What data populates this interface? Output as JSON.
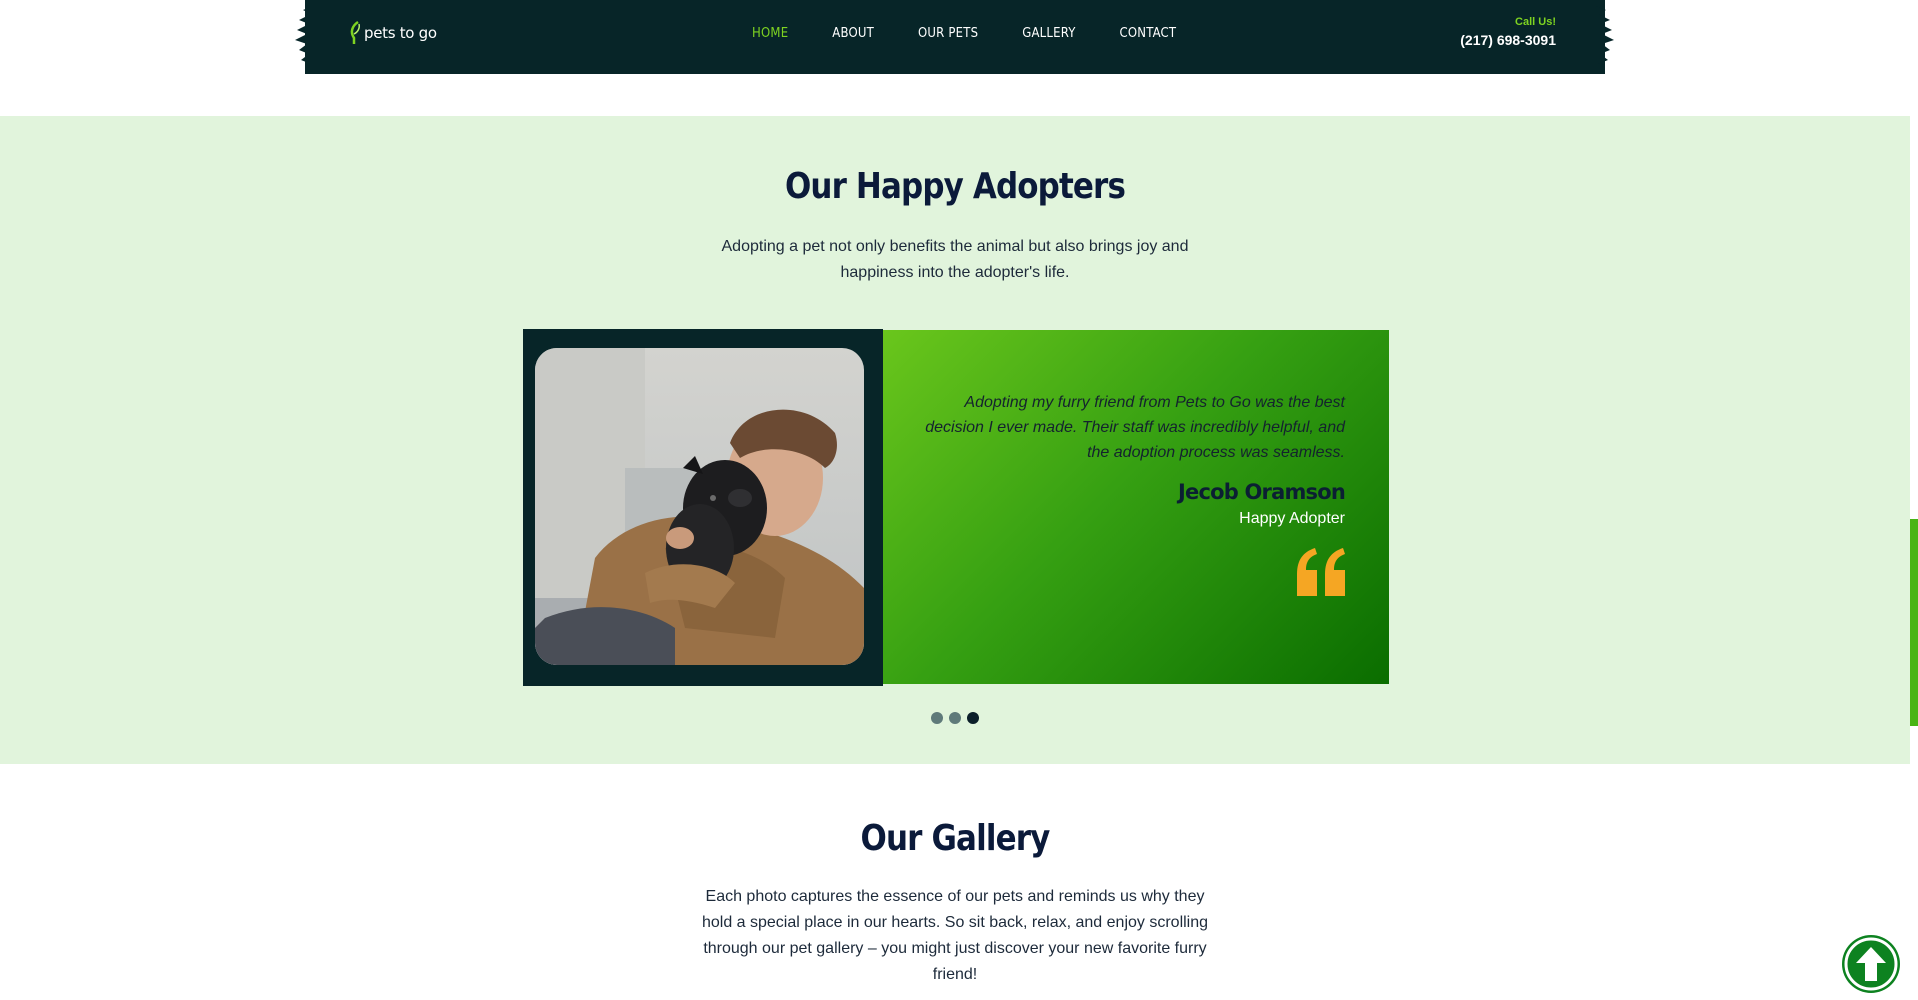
{
  "header": {
    "logo_text": "pets to go",
    "nav": [
      {
        "label": "HOME",
        "active": true
      },
      {
        "label": "ABOUT",
        "active": false
      },
      {
        "label": "OUR PETS",
        "active": false
      },
      {
        "label": "GALLERY",
        "active": false
      },
      {
        "label": "CONTACT",
        "active": false
      }
    ],
    "call_label": "Call Us!",
    "phone": "(217) 698-3091"
  },
  "adopters": {
    "title": "Our Happy Adopters",
    "description_line1": "Adopting a pet not only benefits the animal but also brings joy and",
    "description_line2": "happiness into the adopter's life.",
    "testimonial": {
      "quote_line1": "Adopting my furry friend from Pets to Go was the best",
      "quote_line2": "decision I ever made. Their staff was incredibly helpful, and",
      "quote_line3": "the adoption process was seamless.",
      "name": "Jecob Oramson",
      "role": "Happy Adopter"
    },
    "slider": {
      "total": 3,
      "active_index": 2
    }
  },
  "gallery": {
    "title": "Our Gallery",
    "description_line1": "Each photo captures the essence of our pets and reminds us why they",
    "description_line2": "hold a special place in our hearts. So sit back, relax, and enjoy scrolling",
    "description_line3": "through our pet gallery – you might just discover your new favorite furry",
    "description_line4": "friend!"
  },
  "colors": {
    "header_bg": "#072528",
    "accent_green": "#7ed321",
    "section_bg": "#e1f4dc",
    "quote_mark": "#f5a623",
    "scroll_button": "#0d8220"
  },
  "icons": {
    "quote": "quote-icon",
    "scroll_top": "arrow-up-icon",
    "logo": "leaf-logo-icon"
  }
}
